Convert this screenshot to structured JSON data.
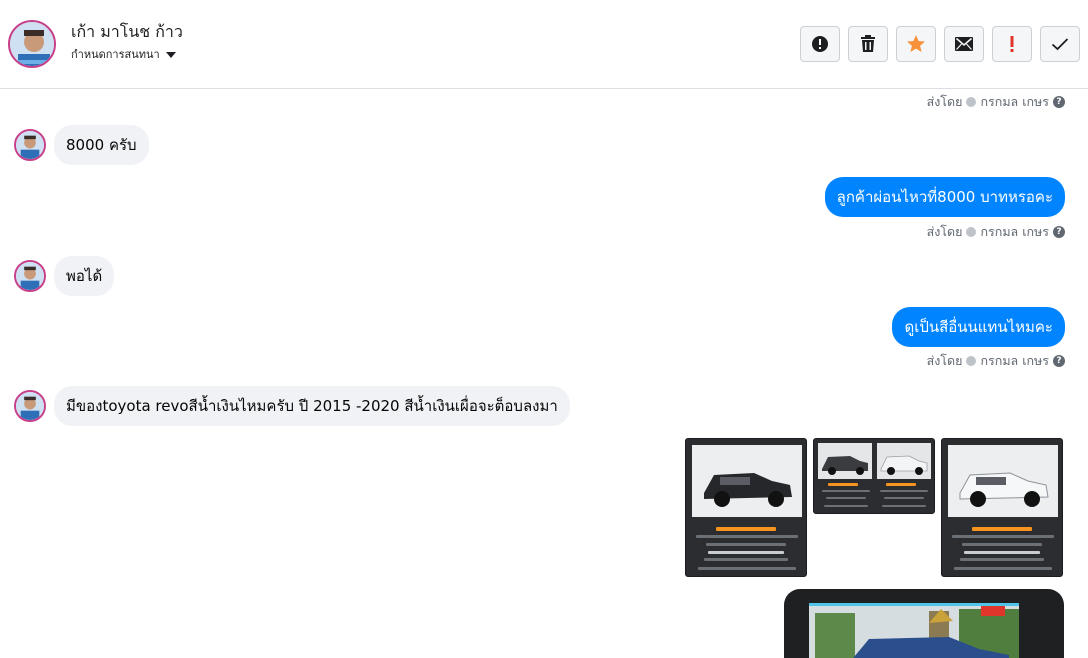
{
  "header": {
    "contact_name": "เก้า มาโนช ก้าว",
    "assign_label": "กำหนดการสนทนา"
  },
  "toolbar": {
    "buttons": [
      "alert-icon",
      "trash-icon",
      "star-icon",
      "mail-icon",
      "exclamation-icon",
      "check-icon"
    ]
  },
  "colors": {
    "sent_bubble": "#0084ff",
    "received_bubble": "#f0f2f5",
    "star": "#f7923a",
    "exclamation": "#e0352b"
  },
  "messages": {
    "sent_by_prefix": "ส่งโดย",
    "sender_name": "กรกมล เกษร",
    "m1": "8000 ครับ",
    "m2": "ลูกค้าผ่อนไหวที่8000 บาทหรอคะ",
    "m3": "พอได้",
    "m4": "ดูเป็นสีอื่นนแทนไหมคะ",
    "m5": "มีของtoyota  revoสีน้ำเงินไหมครับ ปี  2015 -2020  สีน้ำเงินเผื่อจะต็อบลงมา"
  }
}
